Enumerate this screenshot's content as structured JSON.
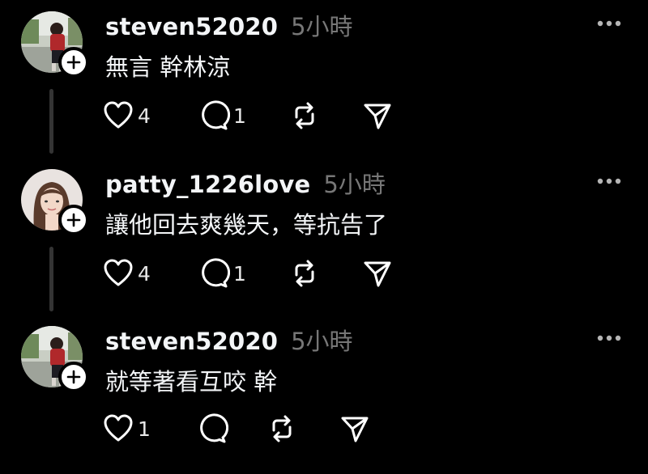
{
  "posts": [
    {
      "username": "steven52020",
      "time": "5小時",
      "text": "無言 幹林涼",
      "likes": "4",
      "replies": "1",
      "avatar": "photo-person-park"
    },
    {
      "username": "patty_1226love",
      "time": "5小時",
      "text": "讓他回去爽幾天，等抗告了",
      "likes": "4",
      "replies": "1",
      "avatar": "photo-woman-portrait"
    },
    {
      "username": "steven52020",
      "time": "5小時",
      "text": "就等著看互咬 幹",
      "likes": "1",
      "replies": "",
      "avatar": "photo-person-park"
    }
  ],
  "icons": {
    "like": "heart-icon",
    "reply": "comment-icon",
    "repost": "repost-icon",
    "share": "send-icon",
    "more": "more-icon",
    "follow": "plus-icon"
  },
  "colors": {
    "background": "#000000",
    "text": "#f3f5f7",
    "muted": "#777777",
    "thread_line": "#343434"
  }
}
